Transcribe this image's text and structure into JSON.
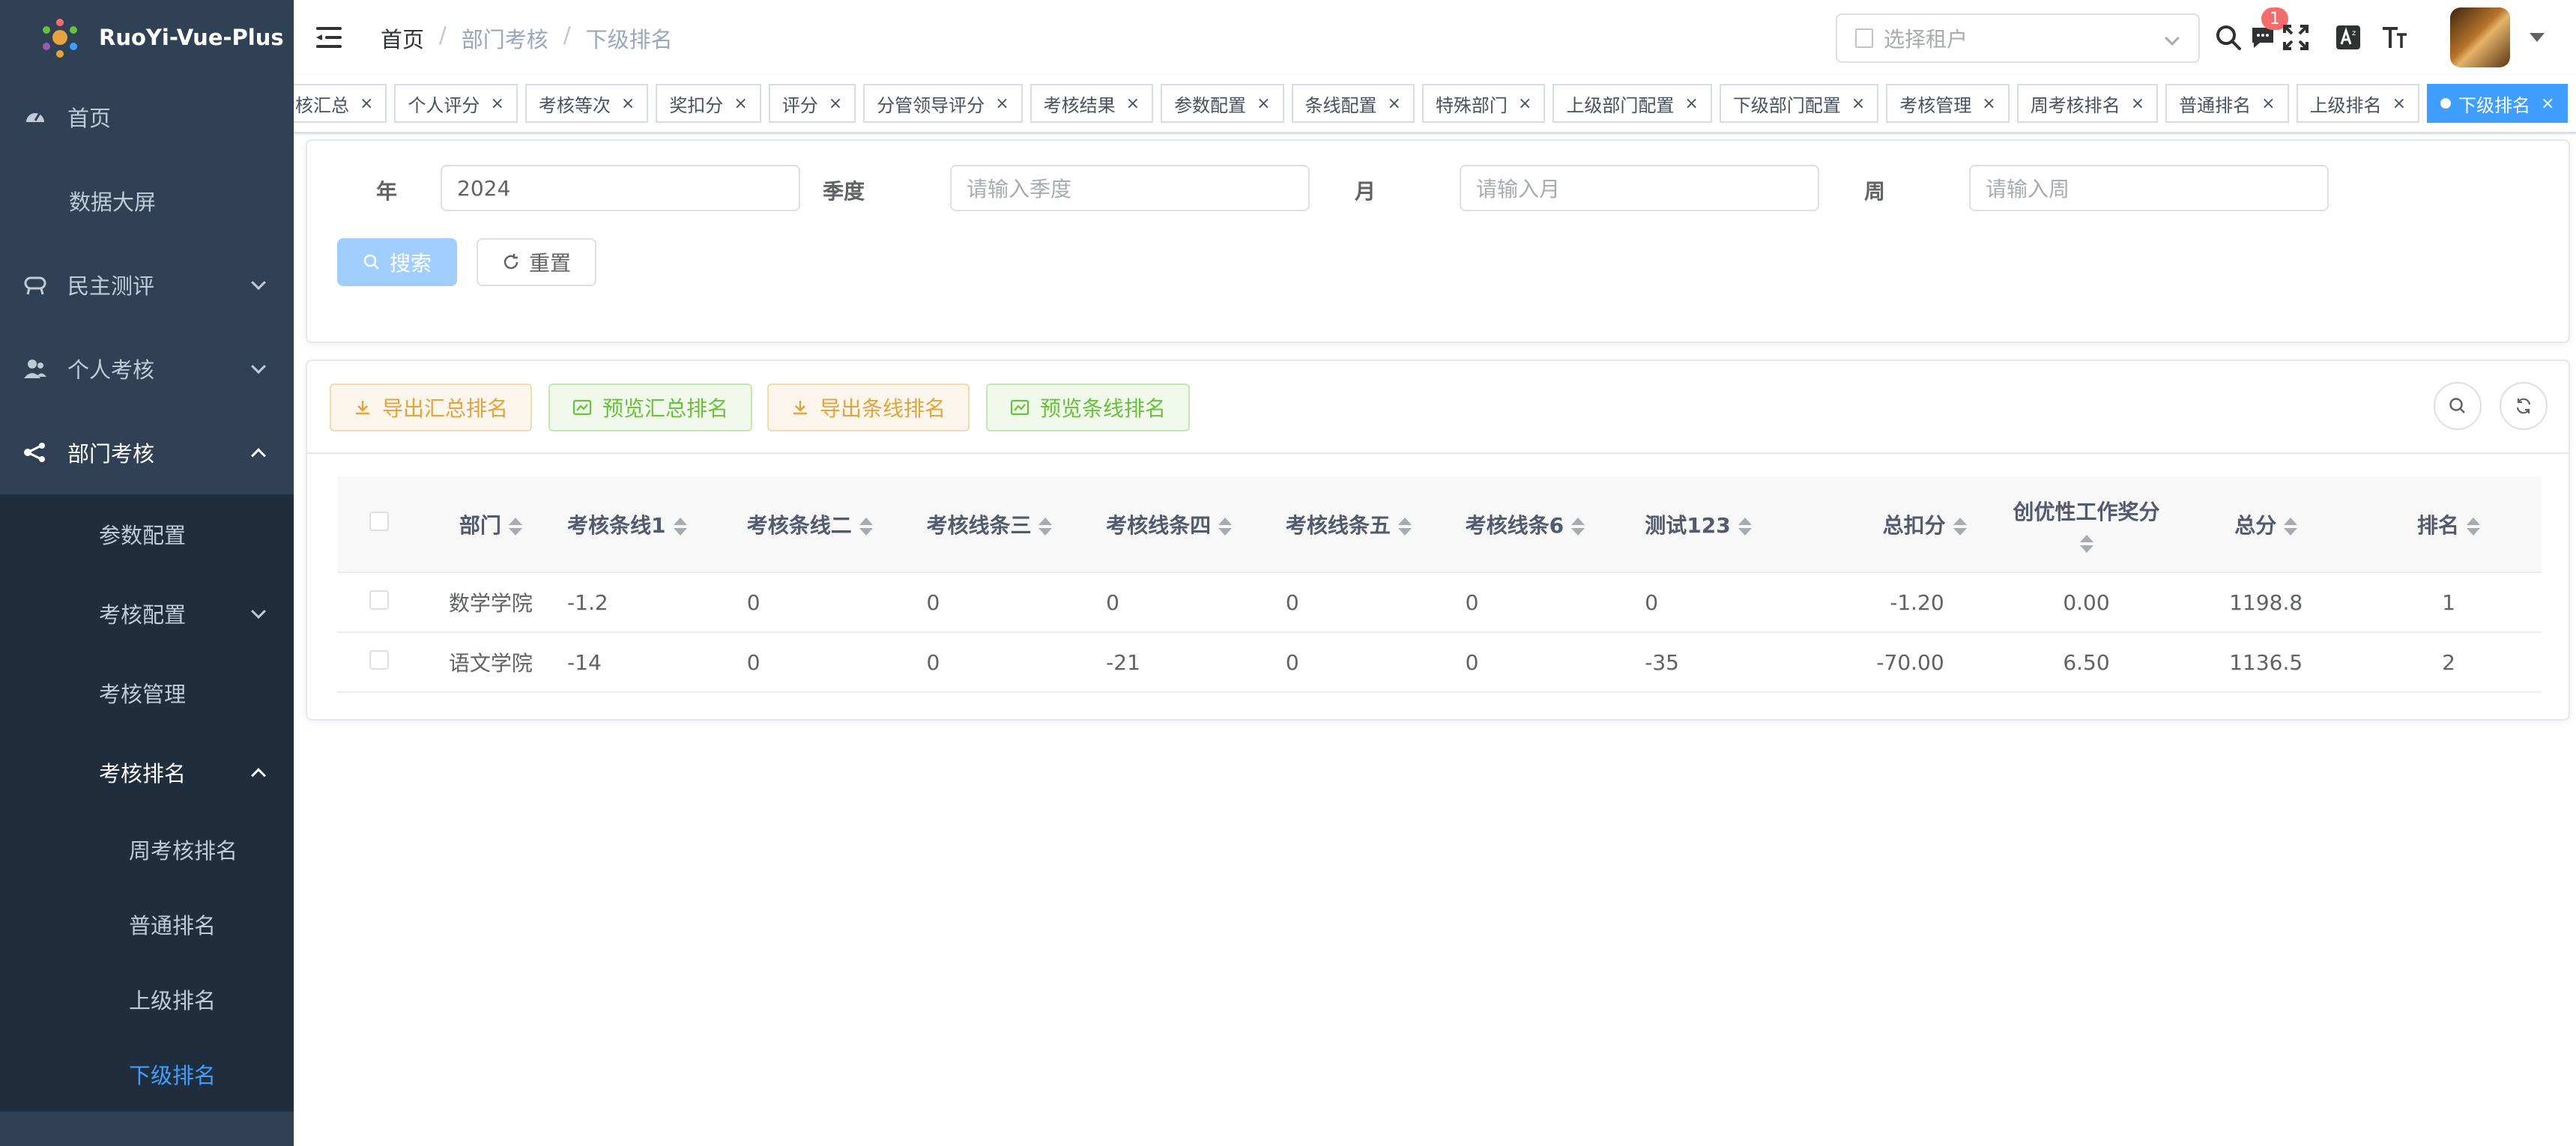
{
  "app": {
    "title": "RuoYi-Vue-Plus"
  },
  "sidebar": {
    "items": [
      {
        "label": "首页",
        "icon": "dashboard-icon"
      },
      {
        "label": "数据大屏"
      },
      {
        "label": "民主测评",
        "icon": "survey-icon"
      },
      {
        "label": "个人考核",
        "icon": "user-icon"
      },
      {
        "label": "部门考核",
        "icon": "tree-icon"
      }
    ],
    "dept_children": [
      {
        "label": "参数配置"
      },
      {
        "label": "考核配置"
      },
      {
        "label": "考核管理"
      },
      {
        "label": "考核排名"
      }
    ],
    "rank_children": [
      {
        "label": "周考核排名"
      },
      {
        "label": "普通排名"
      },
      {
        "label": "上级排名"
      },
      {
        "label": "下级排名"
      }
    ]
  },
  "navbar": {
    "breadcrumb": [
      "首页",
      "部门考核",
      "下级排名"
    ],
    "tenant_placeholder": "选择租户",
    "message_count": "1"
  },
  "tags": [
    "考核汇总",
    "个人评分",
    "考核等次",
    "奖扣分",
    "评分",
    "分管领导评分",
    "考核结果",
    "参数配置",
    "条线配置",
    "特殊部门",
    "上级部门配置",
    "下级部门配置",
    "考核管理",
    "周考核排名",
    "普通排名",
    "上级排名",
    "下级排名"
  ],
  "search": {
    "year_label": "年",
    "year_value": "2024",
    "quarter_label": "季度",
    "quarter_placeholder": "请输入季度",
    "month_label": "月",
    "month_placeholder": "请输入月",
    "week_label": "周",
    "week_placeholder": "请输入周",
    "search_btn": "搜索",
    "reset_btn": "重置"
  },
  "toolbar": {
    "export_total": "导出汇总排名",
    "preview_total": "预览汇总排名",
    "export_line": "导出条线排名",
    "preview_line": "预览条线排名"
  },
  "table": {
    "headers": [
      "部门",
      "考核条线1",
      "考核条线二",
      "考核线条三",
      "考核线条四",
      "考核线条五",
      "考核线条6",
      "测试123",
      "总扣分",
      "创优性工作奖分",
      "总分",
      "排名"
    ],
    "rows": [
      [
        "数学学院",
        "-1.2",
        "0",
        "0",
        "0",
        "0",
        "0",
        "0",
        "-1.20",
        "0.00",
        "1198.8",
        "1"
      ],
      [
        "语文学院",
        "-14",
        "0",
        "0",
        "-21",
        "0",
        "0",
        "-35",
        "-70.00",
        "6.50",
        "1136.5",
        "2"
      ]
    ]
  },
  "colors": {
    "sidebar_bg": "#304156",
    "submenu_bg": "#1f2d3d",
    "accent": "#409eff",
    "warning": "#e6a23c",
    "success": "#67c23a"
  }
}
